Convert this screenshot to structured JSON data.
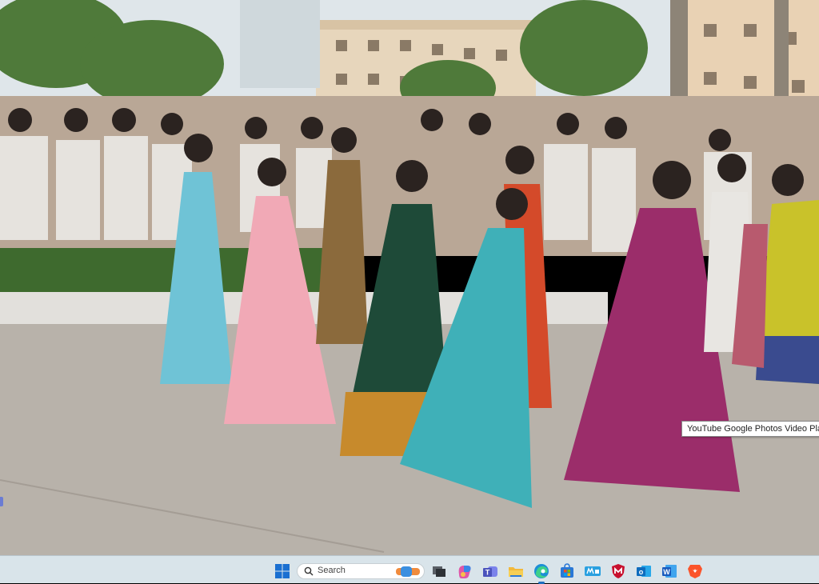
{
  "tooltip": {
    "text": "YouTube Google Photos Video Player"
  },
  "taskbar": {
    "search_placeholder": "Search",
    "icons": [
      {
        "name": "windows-start-icon"
      },
      {
        "name": "search-icon"
      },
      {
        "name": "task-view-icon"
      },
      {
        "name": "copilot-icon"
      },
      {
        "name": "teams-icon"
      },
      {
        "name": "file-explorer-icon"
      },
      {
        "name": "edge-browser-icon"
      },
      {
        "name": "microsoft-store-icon"
      },
      {
        "name": "mcafee-icon"
      },
      {
        "name": "outlook-icon"
      },
      {
        "name": "word-icon"
      },
      {
        "name": "brave-browser-icon"
      }
    ],
    "word_letter": "W",
    "outlook_letter": "o",
    "teams_letter": "T"
  },
  "colors": {
    "taskbar_bg": "#d9e4ea",
    "ground": "#b8b2aa",
    "sky": "#dfe6ea",
    "foliage": "#4f7a3a",
    "dress_blue": "#6fc3d6",
    "dress_pink": "#f1a9b6",
    "dress_green": "#1e4a38",
    "dress_teal": "#3fb0b8",
    "dress_magenta": "#9b2d6a",
    "dress_yellow": "#c9c22a"
  }
}
